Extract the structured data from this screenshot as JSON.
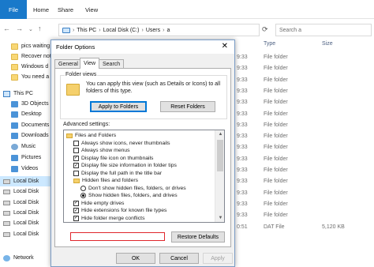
{
  "explorer": {
    "ribbon_tabs": [
      "File",
      "Home",
      "Share",
      "View"
    ],
    "address": [
      "This PC",
      "Local Disk (C:)",
      "Users",
      "a"
    ],
    "search_placeholder": "Search a",
    "columns": [
      "Type",
      "Size"
    ],
    "nav_items": [
      {
        "label": "pics waiting",
        "icon": "folder-icon"
      },
      {
        "label": "Recover not",
        "icon": "folder-icon"
      },
      {
        "label": "Windows d",
        "icon": "folder-icon"
      },
      {
        "label": "You need a",
        "icon": "folder-icon"
      },
      {
        "label": "This PC",
        "icon": "pc-icon"
      },
      {
        "label": "3D Objects",
        "icon": "cube-icon"
      },
      {
        "label": "Desktop",
        "icon": "desktop-icon"
      },
      {
        "label": "Documents",
        "icon": "documents-icon"
      },
      {
        "label": "Downloads",
        "icon": "download-icon"
      },
      {
        "label": "Music",
        "icon": "music-icon"
      },
      {
        "label": "Pictures",
        "icon": "pictures-icon"
      },
      {
        "label": "Videos",
        "icon": "videos-icon"
      },
      {
        "label": "Local Disk",
        "icon": "drive-icon"
      },
      {
        "label": "Local Disk",
        "icon": "drive-icon"
      },
      {
        "label": "Local Disk",
        "icon": "drive-icon"
      },
      {
        "label": "Local Disk",
        "icon": "drive-icon"
      },
      {
        "label": "Local Disk",
        "icon": "drive-icon"
      },
      {
        "label": "Local Disk",
        "icon": "drive-icon"
      },
      {
        "label": "Network",
        "icon": "network-icon"
      }
    ],
    "files": [
      {
        "time": "9:33",
        "type": "File folder",
        "size": ""
      },
      {
        "time": "9:33",
        "type": "File folder",
        "size": ""
      },
      {
        "time": "9:33",
        "type": "File folder",
        "size": ""
      },
      {
        "time": "9:33",
        "type": "File folder",
        "size": ""
      },
      {
        "time": "9:33",
        "type": "File folder",
        "size": ""
      },
      {
        "time": "9:33",
        "type": "File folder",
        "size": ""
      },
      {
        "time": "9:33",
        "type": "File folder",
        "size": ""
      },
      {
        "time": "9:33",
        "type": "File folder",
        "size": ""
      },
      {
        "time": "9:33",
        "type": "File folder",
        "size": ""
      },
      {
        "time": "9:33",
        "type": "File folder",
        "size": ""
      },
      {
        "time": "9:33",
        "type": "File folder",
        "size": ""
      },
      {
        "time": "9:33",
        "type": "File folder",
        "size": ""
      },
      {
        "time": "9:33",
        "type": "File folder",
        "size": ""
      },
      {
        "time": "9:33",
        "type": "File folder",
        "size": ""
      },
      {
        "time": "9:33",
        "type": "File folder",
        "size": ""
      },
      {
        "time": "0:51",
        "type": "DAT File",
        "size": "5,120 KB"
      }
    ]
  },
  "dialog": {
    "title": "Folder Options",
    "tabs": [
      "General",
      "View",
      "Search"
    ],
    "active_tab": "View",
    "folder_views_legend": "Folder views",
    "folder_views_desc": "You can apply this view (such as Details or Icons) to all folders of this type.",
    "apply_button": "Apply to Folders",
    "reset_button": "Reset Folders",
    "advanced_label": "Advanced settings:",
    "settings": [
      {
        "kind": "folder",
        "label": "Files and Folders",
        "indent": 0
      },
      {
        "kind": "check",
        "label": "Always show icons, never thumbnails",
        "checked": false,
        "indent": 1
      },
      {
        "kind": "check",
        "label": "Always show menus",
        "checked": false,
        "indent": 1
      },
      {
        "kind": "check",
        "label": "Display file icon on thumbnails",
        "checked": true,
        "indent": 1
      },
      {
        "kind": "check",
        "label": "Display file size information in folder tips",
        "checked": true,
        "indent": 1
      },
      {
        "kind": "check",
        "label": "Display the full path in the title bar",
        "checked": false,
        "indent": 1
      },
      {
        "kind": "folder",
        "label": "Hidden files and folders",
        "indent": 1
      },
      {
        "kind": "radio",
        "label": "Don't show hidden files, folders, or drives",
        "checked": false,
        "indent": 2
      },
      {
        "kind": "radio",
        "label": "Show hidden files, folders, and drives",
        "checked": true,
        "indent": 2
      },
      {
        "kind": "check",
        "label": "Hide empty drives",
        "checked": true,
        "indent": 1
      },
      {
        "kind": "check",
        "label": "Hide extensions for known file types",
        "checked": true,
        "indent": 1
      },
      {
        "kind": "check",
        "label": "Hide folder merge conflicts",
        "checked": true,
        "indent": 1
      }
    ],
    "restore_button": "Restore Defaults",
    "ok_button": "OK",
    "cancel_button": "Cancel",
    "apply_bottom_button": "Apply"
  }
}
